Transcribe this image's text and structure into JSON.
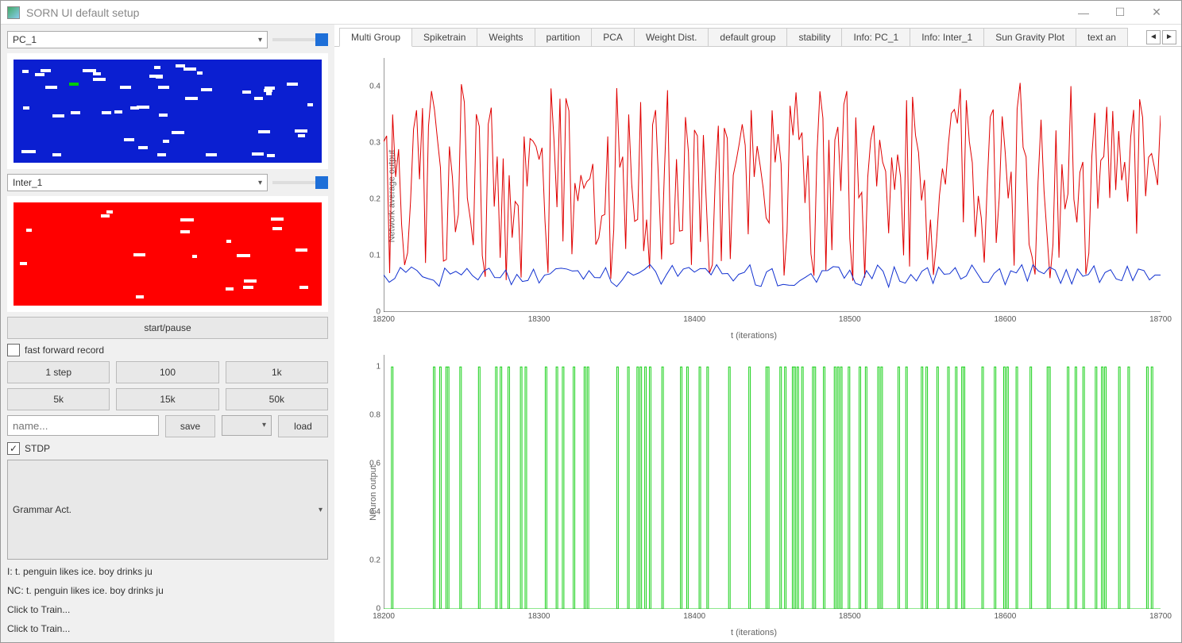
{
  "window": {
    "title": "SORN UI default setup"
  },
  "sidebar": {
    "combo1": "PC_1",
    "combo2": "Inter_1",
    "start_pause": "start/pause",
    "ff_record": "fast forward record",
    "steps": [
      "1 step",
      "100",
      "1k",
      "5k",
      "15k",
      "50k"
    ],
    "name_placeholder": "name...",
    "save": "save",
    "load": "load",
    "stdp": "STDP",
    "grammar": "Grammar Act.",
    "lines": [
      "I: t. penguin likes ice. boy drinks ju",
      "NC: t. penguin likes ice. boy drinks ju",
      "Click to Train...",
      "Click to Train..."
    ]
  },
  "tabs": [
    "Multi Group",
    "Spiketrain",
    "Weights",
    "partition",
    "PCA",
    "Weight Dist.",
    "default group",
    "stability",
    "Info: PC_1",
    "Info: Inter_1",
    "Sun Gravity Plot",
    "text an"
  ],
  "active_tab": 0,
  "chart_data": [
    {
      "type": "line",
      "title": "",
      "xlabel": "t (iterations)",
      "ylabel": "Network average output",
      "xlim": [
        18200,
        18700
      ],
      "ylim": [
        0,
        0.45
      ],
      "yticks": [
        0,
        0.1,
        0.2,
        0.3,
        0.4
      ],
      "xticks": [
        18200,
        18300,
        18400,
        18500,
        18600,
        18700
      ],
      "series": [
        {
          "name": "red",
          "color": "#e00000",
          "noisy": true,
          "base": 0.1,
          "amp": 0.18,
          "freq": 260
        },
        {
          "name": "blue",
          "color": "#1030d0",
          "noisy": true,
          "base": 0.05,
          "amp": 0.02,
          "freq": 140
        }
      ]
    },
    {
      "type": "line",
      "title": "",
      "xlabel": "t (iterations)",
      "ylabel": "Neuron output",
      "xlim": [
        18200,
        18700
      ],
      "ylim": [
        0,
        1.05
      ],
      "yticks": [
        0,
        0.2,
        0.4,
        0.6,
        0.8,
        1
      ],
      "xticks": [
        18200,
        18300,
        18400,
        18500,
        18600,
        18700
      ],
      "series": [
        {
          "name": "green",
          "color": "#18d018",
          "spikes": true,
          "density": 0.24
        }
      ]
    }
  ]
}
